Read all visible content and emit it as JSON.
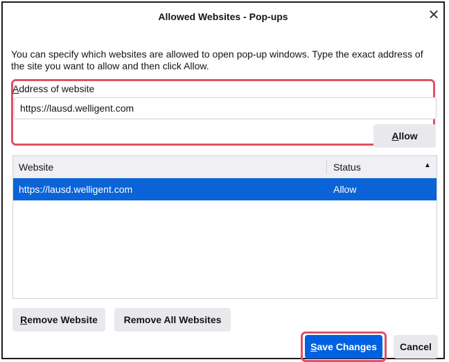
{
  "window": {
    "title": "Allowed Websites - Pop-ups",
    "close_glyph": "✕"
  },
  "description": "You can specify which websites are allowed to open pop-up windows. Type the exact address of the site you want to allow and then click Allow.",
  "address": {
    "label": "Address of website",
    "value": "https://lausd.welligent.com"
  },
  "buttons": {
    "allow": "Allow",
    "remove_website": "Remove Website",
    "remove_all": "Remove All Websites",
    "save": "Save Changes",
    "cancel": "Cancel"
  },
  "table": {
    "columns": [
      "Website",
      "Status"
    ],
    "sort_glyph": "▲",
    "rows": [
      {
        "website": "https://lausd.welligent.com",
        "status": "Allow",
        "selected": true
      }
    ]
  },
  "colors": {
    "highlight": "#e05161",
    "selection": "#0a64d8",
    "primary_button": "#0061e0"
  }
}
